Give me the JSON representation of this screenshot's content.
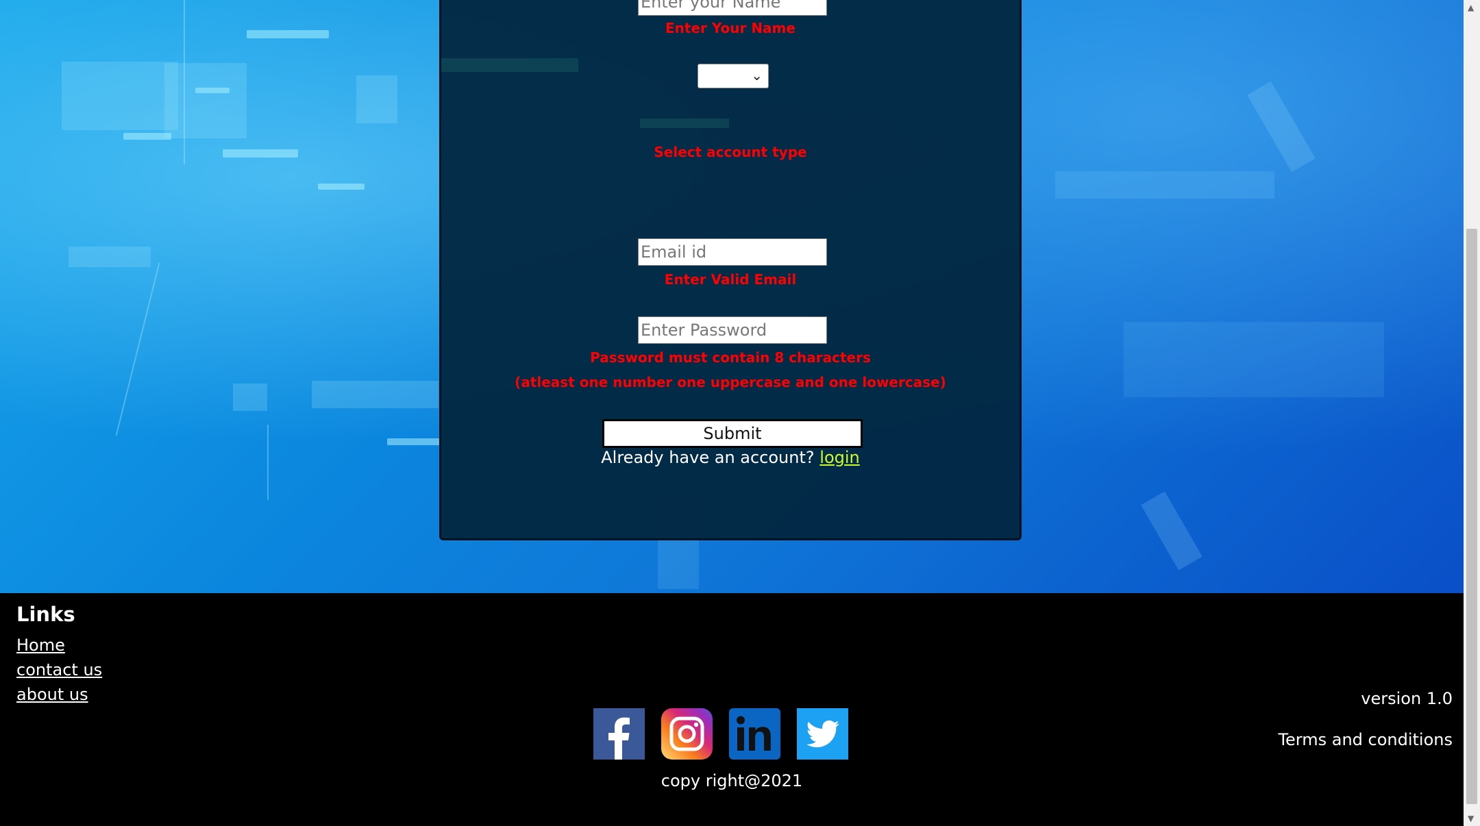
{
  "form": {
    "name_placeholder": "Enter your Name",
    "name_error": "Enter Your Name",
    "account_type_value": "",
    "account_type_error": "Select account type",
    "email_placeholder": "Email id",
    "email_error": "Enter Valid Email",
    "password_placeholder": "Enter Password",
    "password_error_line1": "Password must contain 8 characters",
    "password_error_line2": "(atleast one number one uppercase and one lowercase)",
    "submit_label": "Submit",
    "already_text": "Already have an account?",
    "login_link": "login"
  },
  "footer": {
    "links_title": "Links",
    "links": [
      "Home",
      "contact us",
      "about us"
    ],
    "socials": [
      "facebook-icon",
      "instagram-icon",
      "linkedin-icon",
      "twitter-icon"
    ],
    "copyright": "copy right@2021",
    "version": "version 1.0",
    "terms": "Terms and conditions"
  },
  "colors": {
    "error": "#ff0000",
    "login_link": "#cdfb2a",
    "card_bg": "#022842",
    "footer_bg": "#000000"
  }
}
